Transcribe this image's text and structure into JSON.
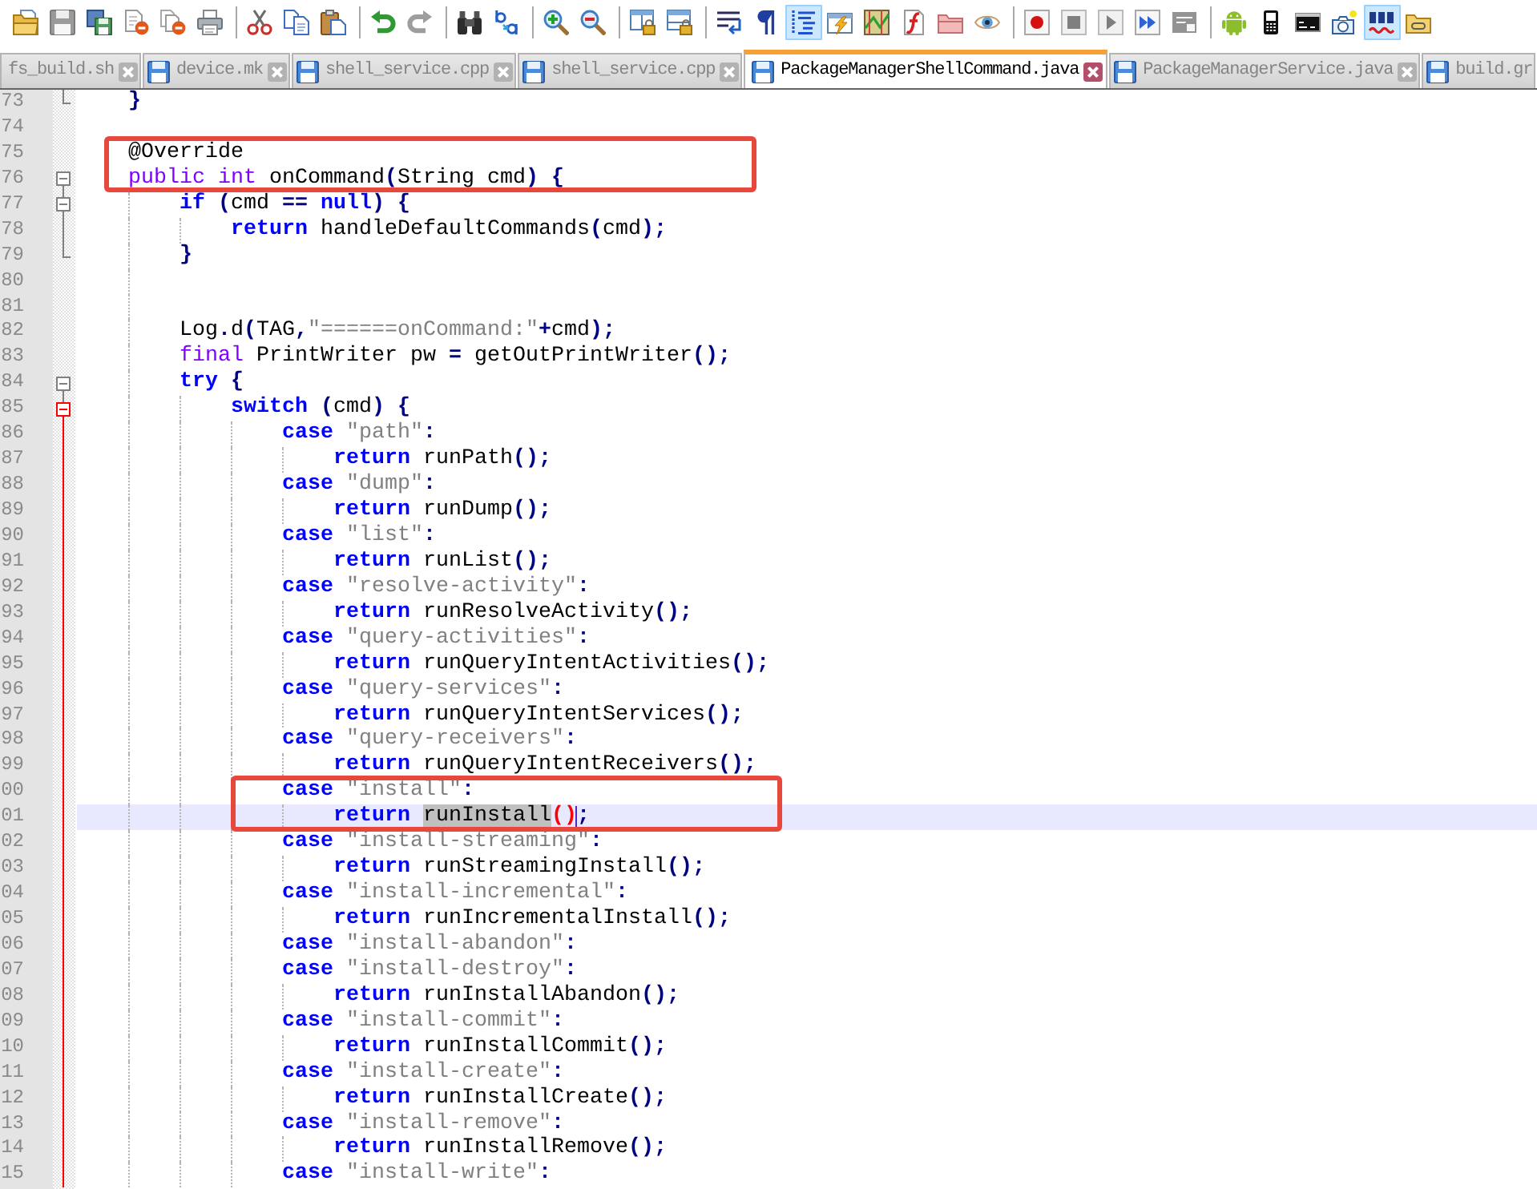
{
  "toolbar": {
    "groups": [
      [
        {
          "kind": "open",
          "pressed": false,
          "disabled": false
        },
        {
          "kind": "save",
          "pressed": false,
          "disabled": true
        },
        {
          "kind": "saveall",
          "pressed": false,
          "disabled": false
        },
        {
          "kind": "close",
          "pressed": false,
          "disabled": false
        },
        {
          "kind": "closeall",
          "pressed": false,
          "disabled": false
        },
        {
          "kind": "print",
          "pressed": false,
          "disabled": false
        }
      ],
      [
        {
          "kind": "cut",
          "pressed": false,
          "disabled": false
        },
        {
          "kind": "copy",
          "pressed": false,
          "disabled": false
        },
        {
          "kind": "paste",
          "pressed": false,
          "disabled": false
        }
      ],
      [
        {
          "kind": "undo",
          "pressed": false,
          "disabled": false
        },
        {
          "kind": "redo",
          "pressed": false,
          "disabled": true
        }
      ],
      [
        {
          "kind": "find",
          "pressed": false,
          "disabled": false
        },
        {
          "kind": "replace",
          "pressed": false,
          "disabled": false
        }
      ],
      [
        {
          "kind": "zoomin",
          "pressed": false,
          "disabled": false
        },
        {
          "kind": "zoomout",
          "pressed": false,
          "disabled": false
        }
      ],
      [
        {
          "kind": "syncv",
          "pressed": false,
          "disabled": false
        },
        {
          "kind": "synch",
          "pressed": false,
          "disabled": false
        }
      ],
      [
        {
          "kind": "wrap",
          "pressed": false,
          "disabled": false
        },
        {
          "kind": "allchars",
          "pressed": false,
          "disabled": false
        },
        {
          "kind": "indentguide",
          "pressed": true,
          "disabled": false
        },
        {
          "kind": "udl",
          "pressed": false,
          "disabled": false
        },
        {
          "kind": "docmap",
          "pressed": false,
          "disabled": false
        },
        {
          "kind": "funclist",
          "pressed": false,
          "disabled": false
        },
        {
          "kind": "folder",
          "pressed": false,
          "disabled": false
        },
        {
          "kind": "monitor",
          "pressed": false,
          "disabled": false
        }
      ],
      [
        {
          "kind": "record",
          "pressed": false,
          "disabled": false
        },
        {
          "kind": "stop",
          "pressed": false,
          "disabled": true
        },
        {
          "kind": "play",
          "pressed": false,
          "disabled": true
        },
        {
          "kind": "playmulti",
          "pressed": false,
          "disabled": false
        },
        {
          "kind": "savemacro",
          "pressed": false,
          "disabled": true
        }
      ],
      [
        {
          "kind": "android",
          "pressed": false,
          "disabled": false
        },
        {
          "kind": "phone",
          "pressed": false,
          "disabled": false
        },
        {
          "kind": "console",
          "pressed": false,
          "disabled": false
        },
        {
          "kind": "snapshot",
          "pressed": false,
          "disabled": false
        },
        {
          "kind": "spellcheck",
          "pressed": true,
          "disabled": false
        },
        {
          "kind": "plugin",
          "pressed": false,
          "disabled": false
        }
      ]
    ]
  },
  "tabs": [
    {
      "label": "fs_build.sh",
      "selected": false,
      "file_icon": false,
      "close_button": true
    },
    {
      "label": "device.mk",
      "selected": false,
      "file_icon": true,
      "close_button": true
    },
    {
      "label": "shell_service.cpp",
      "selected": false,
      "file_icon": true,
      "close_button": true
    },
    {
      "label": "shell_service.cpp",
      "selected": false,
      "file_icon": true,
      "close_button": true
    },
    {
      "label": "PackageManagerShellCommand.java",
      "selected": true,
      "file_icon": true,
      "close_button": true
    },
    {
      "label": "PackageManagerService.java",
      "selected": false,
      "file_icon": true,
      "close_button": true
    },
    {
      "label": "build.gr",
      "selected": false,
      "file_icon": true,
      "close_button": false
    }
  ],
  "editor": {
    "lines": [
      {
        "number": "73",
        "kind": "end",
        "current_fold": false,
        "current": false,
        "annotated": false,
        "tokens": [
          {
            "kind": "operator",
            "text": "}"
          }
        ]
      },
      {
        "number": "74",
        "kind": "plain",
        "current": false,
        "annotated": false
      },
      {
        "number": "75",
        "kind": "plain",
        "current": false,
        "annotated": true,
        "tokens": [
          {
            "kind": "text",
            "text": "@Override"
          }
        ]
      },
      {
        "number": "76",
        "kind": "start",
        "current_fold": false,
        "current": false,
        "annotated": true,
        "tokens": [
          {
            "kind": "type",
            "text": "public"
          },
          {
            "kind": "type",
            "text": " int"
          },
          {
            "kind": "text",
            "text": " onCommand"
          },
          {
            "kind": "operator",
            "text": "("
          },
          {
            "kind": "text",
            "text": "String cmd"
          },
          {
            "kind": "operator",
            "text": ")"
          },
          {
            "kind": "operator",
            "text": " {"
          }
        ],
        "children": [
          {
            "number": "77",
            "kind": "start",
            "current_fold": false,
            "current": false,
            "annotated": false,
            "tokens": [
              {
                "kind": "keyword",
                "text": "if"
              },
              {
                "kind": "operator",
                "text": " ("
              },
              {
                "kind": "text",
                "text": "cmd "
              },
              {
                "kind": "operator",
                "text": "=="
              },
              {
                "kind": "keyword",
                "text": " null"
              },
              {
                "kind": "operator",
                "text": ")"
              },
              {
                "kind": "operator",
                "text": " {"
              }
            ],
            "children": [
              {
                "number": "78",
                "kind": "inside",
                "current_fold": false,
                "current": false,
                "annotated": false,
                "tokens": [
                  {
                    "kind": "keyword",
                    "text": "return"
                  },
                  {
                    "kind": "text",
                    "text": " handleDefaultCommands"
                  },
                  {
                    "kind": "operator",
                    "text": "("
                  },
                  {
                    "kind": "text",
                    "text": "cmd"
                  },
                  {
                    "kind": "operator",
                    "text": ");"
                  }
                ]
              }
            ]
          },
          {
            "number": "79",
            "kind": "end",
            "current_fold": false,
            "current": false,
            "annotated": false,
            "tokens": [
              {
                "kind": "operator",
                "text": "}"
              }
            ]
          },
          {
            "number": "80",
            "kind": "plain",
            "current": false,
            "annotated": false
          },
          {
            "number": "81",
            "kind": "plain",
            "current": false,
            "annotated": false
          },
          {
            "number": "82",
            "kind": "plain",
            "current": false,
            "annotated": false,
            "tokens": [
              {
                "kind": "text",
                "text": "Log"
              },
              {
                "kind": "operator",
                "text": "."
              },
              {
                "kind": "text",
                "text": "d"
              },
              {
                "kind": "operator",
                "text": "("
              },
              {
                "kind": "text",
                "text": "TAG"
              },
              {
                "kind": "operator",
                "text": ","
              },
              {
                "kind": "string",
                "text": "\"======onCommand:\""
              },
              {
                "kind": "operator",
                "text": "+"
              },
              {
                "kind": "text",
                "text": "cmd"
              },
              {
                "kind": "operator",
                "text": ");"
              }
            ]
          },
          {
            "number": "83",
            "kind": "plain",
            "current": false,
            "annotated": false,
            "tokens": [
              {
                "kind": "type",
                "text": "final"
              },
              {
                "kind": "text",
                "text": " PrintWriter pw "
              },
              {
                "kind": "operator",
                "text": "="
              },
              {
                "kind": "text",
                "text": " getOutPrintWriter"
              },
              {
                "kind": "operator",
                "text": "();"
              }
            ]
          },
          {
            "number": "84",
            "kind": "start",
            "current_fold": false,
            "current": false,
            "annotated": false,
            "tokens": [
              {
                "kind": "keyword",
                "text": "try"
              },
              {
                "kind": "operator",
                "text": " {"
              }
            ],
            "children": [
              {
                "number": "85",
                "kind": "start",
                "current_fold": true,
                "current": false,
                "annotated": false,
                "tokens": [
                  {
                    "kind": "keyword",
                    "text": "switch"
                  },
                  {
                    "kind": "operator",
                    "text": " ("
                  },
                  {
                    "kind": "text",
                    "text": "cmd"
                  },
                  {
                    "kind": "operator",
                    "text": ")"
                  },
                  {
                    "kind": "operator",
                    "text": " {"
                  }
                ],
                "children": [
                  {
                    "number": "86",
                    "kind": "inside",
                    "current_fold": true,
                    "current": false,
                    "annotated": false,
                    "tokens": [
                      {
                        "kind": "keyword",
                        "text": "case"
                      },
                      {
                        "kind": "string",
                        "text": " \"path\""
                      },
                      {
                        "kind": "operator",
                        "text": ":"
                      }
                    ],
                    "children": [
                      {
                        "number": "87",
                        "kind": "inside",
                        "current_fold": true,
                        "current": false,
                        "annotated": false,
                        "tokens": [
                          {
                            "kind": "keyword",
                            "text": "return"
                          },
                          {
                            "kind": "text",
                            "text": " runPath"
                          },
                          {
                            "kind": "operator",
                            "text": "();"
                          }
                        ]
                      }
                    ]
                  },
                  {
                    "number": "88",
                    "kind": "inside",
                    "current_fold": true,
                    "current": false,
                    "annotated": false,
                    "tokens": [
                      {
                        "kind": "keyword",
                        "text": "case"
                      },
                      {
                        "kind": "string",
                        "text": " \"dump\""
                      },
                      {
                        "kind": "operator",
                        "text": ":"
                      }
                    ],
                    "children": [
                      {
                        "number": "89",
                        "kind": "inside",
                        "current_fold": true,
                        "current": false,
                        "annotated": false,
                        "tokens": [
                          {
                            "kind": "keyword",
                            "text": "return"
                          },
                          {
                            "kind": "text",
                            "text": " runDump"
                          },
                          {
                            "kind": "operator",
                            "text": "();"
                          }
                        ]
                      }
                    ]
                  },
                  {
                    "number": "90",
                    "kind": "inside",
                    "current_fold": true,
                    "current": false,
                    "annotated": false,
                    "tokens": [
                      {
                        "kind": "keyword",
                        "text": "case"
                      },
                      {
                        "kind": "string",
                        "text": " \"list\""
                      },
                      {
                        "kind": "operator",
                        "text": ":"
                      }
                    ],
                    "children": [
                      {
                        "number": "91",
                        "kind": "inside",
                        "current_fold": true,
                        "current": false,
                        "annotated": false,
                        "tokens": [
                          {
                            "kind": "keyword",
                            "text": "return"
                          },
                          {
                            "kind": "text",
                            "text": " runList"
                          },
                          {
                            "kind": "operator",
                            "text": "();"
                          }
                        ]
                      }
                    ]
                  },
                  {
                    "number": "92",
                    "kind": "inside",
                    "current_fold": true,
                    "current": false,
                    "annotated": false,
                    "tokens": [
                      {
                        "kind": "keyword",
                        "text": "case"
                      },
                      {
                        "kind": "string",
                        "text": " \"resolve-activity\""
                      },
                      {
                        "kind": "operator",
                        "text": ":"
                      }
                    ],
                    "children": [
                      {
                        "number": "93",
                        "kind": "inside",
                        "current_fold": true,
                        "current": false,
                        "annotated": false,
                        "tokens": [
                          {
                            "kind": "keyword",
                            "text": "return"
                          },
                          {
                            "kind": "text",
                            "text": " runResolveActivity"
                          },
                          {
                            "kind": "operator",
                            "text": "();"
                          }
                        ]
                      }
                    ]
                  },
                  {
                    "number": "94",
                    "kind": "inside",
                    "current_fold": true,
                    "current": false,
                    "annotated": false,
                    "tokens": [
                      {
                        "kind": "keyword",
                        "text": "case"
                      },
                      {
                        "kind": "string",
                        "text": " \"query-activities\""
                      },
                      {
                        "kind": "operator",
                        "text": ":"
                      }
                    ],
                    "children": [
                      {
                        "number": "95",
                        "kind": "inside",
                        "current_fold": true,
                        "current": false,
                        "annotated": false,
                        "tokens": [
                          {
                            "kind": "keyword",
                            "text": "return"
                          },
                          {
                            "kind": "text",
                            "text": " runQueryIntentActivities"
                          },
                          {
                            "kind": "operator",
                            "text": "();"
                          }
                        ]
                      }
                    ]
                  },
                  {
                    "number": "96",
                    "kind": "inside",
                    "current_fold": true,
                    "current": false,
                    "annotated": false,
                    "tokens": [
                      {
                        "kind": "keyword",
                        "text": "case"
                      },
                      {
                        "kind": "string",
                        "text": " \"query-services\""
                      },
                      {
                        "kind": "operator",
                        "text": ":"
                      }
                    ],
                    "children": [
                      {
                        "number": "97",
                        "kind": "inside",
                        "current_fold": true,
                        "current": false,
                        "annotated": false,
                        "tokens": [
                          {
                            "kind": "keyword",
                            "text": "return"
                          },
                          {
                            "kind": "text",
                            "text": " runQueryIntentServices"
                          },
                          {
                            "kind": "operator",
                            "text": "();"
                          }
                        ]
                      }
                    ]
                  },
                  {
                    "number": "98",
                    "kind": "inside",
                    "current_fold": true,
                    "current": false,
                    "annotated": false,
                    "tokens": [
                      {
                        "kind": "keyword",
                        "text": "case"
                      },
                      {
                        "kind": "string",
                        "text": " \"query-receivers\""
                      },
                      {
                        "kind": "operator",
                        "text": ":"
                      }
                    ],
                    "children": [
                      {
                        "number": "99",
                        "kind": "inside",
                        "current_fold": true,
                        "current": false,
                        "annotated": false,
                        "tokens": [
                          {
                            "kind": "keyword",
                            "text": "return"
                          },
                          {
                            "kind": "text",
                            "text": " runQueryIntentReceivers"
                          },
                          {
                            "kind": "operator",
                            "text": "();"
                          }
                        ]
                      }
                    ]
                  },
                  {
                    "number": "00",
                    "kind": "inside",
                    "current_fold": true,
                    "current": false,
                    "annotated": true,
                    "tokens": [
                      {
                        "kind": "keyword",
                        "text": "case"
                      },
                      {
                        "kind": "string",
                        "text": " \"install\""
                      },
                      {
                        "kind": "operator",
                        "text": ":"
                      }
                    ],
                    "children": [
                      {
                        "number": "01",
                        "kind": "inside",
                        "current_fold": true,
                        "current": true,
                        "annotated": true,
                        "tokens": [
                          {
                            "kind": "keyword",
                            "text": "return "
                          },
                          {
                            "kind": "selection",
                            "text": "runInstall"
                          },
                          {
                            "kind": "brace",
                            "text": "("
                          },
                          {
                            "kind": "brace",
                            "text": ")"
                          },
                          {
                            "kind": "caret"
                          },
                          {
                            "kind": "operator",
                            "text": ";"
                          }
                        ]
                      }
                    ]
                  },
                  {
                    "number": "02",
                    "kind": "inside",
                    "current_fold": true,
                    "current": false,
                    "annotated": false,
                    "tokens": [
                      {
                        "kind": "keyword",
                        "text": "case"
                      },
                      {
                        "kind": "string",
                        "text": " \"install-streaming\""
                      },
                      {
                        "kind": "operator",
                        "text": ":"
                      }
                    ],
                    "children": [
                      {
                        "number": "03",
                        "kind": "inside",
                        "current_fold": true,
                        "current": false,
                        "annotated": false,
                        "tokens": [
                          {
                            "kind": "keyword",
                            "text": "return"
                          },
                          {
                            "kind": "text",
                            "text": " runStreamingInstall"
                          },
                          {
                            "kind": "operator",
                            "text": "();"
                          }
                        ]
                      }
                    ]
                  },
                  {
                    "number": "04",
                    "kind": "inside",
                    "current_fold": true,
                    "current": false,
                    "annotated": false,
                    "tokens": [
                      {
                        "kind": "keyword",
                        "text": "case"
                      },
                      {
                        "kind": "string",
                        "text": " \"install-incremental\""
                      },
                      {
                        "kind": "operator",
                        "text": ":"
                      }
                    ],
                    "children": [
                      {
                        "number": "05",
                        "kind": "inside",
                        "current_fold": true,
                        "current": false,
                        "annotated": false,
                        "tokens": [
                          {
                            "kind": "keyword",
                            "text": "return"
                          },
                          {
                            "kind": "text",
                            "text": " runIncrementalInstall"
                          },
                          {
                            "kind": "operator",
                            "text": "();"
                          }
                        ]
                      }
                    ]
                  },
                  {
                    "number": "06",
                    "kind": "inside",
                    "current_fold": true,
                    "current": false,
                    "annotated": false,
                    "tokens": [
                      {
                        "kind": "keyword",
                        "text": "case"
                      },
                      {
                        "kind": "string",
                        "text": " \"install-abandon\""
                      },
                      {
                        "kind": "operator",
                        "text": ":"
                      }
                    ]
                  },
                  {
                    "number": "07",
                    "kind": "inside",
                    "current_fold": true,
                    "current": false,
                    "annotated": false,
                    "tokens": [
                      {
                        "kind": "keyword",
                        "text": "case"
                      },
                      {
                        "kind": "string",
                        "text": " \"install-destroy\""
                      },
                      {
                        "kind": "operator",
                        "text": ":"
                      }
                    ],
                    "children": [
                      {
                        "number": "08",
                        "kind": "inside",
                        "current_fold": true,
                        "current": false,
                        "annotated": false,
                        "tokens": [
                          {
                            "kind": "keyword",
                            "text": "return"
                          },
                          {
                            "kind": "text",
                            "text": " runInstallAbandon"
                          },
                          {
                            "kind": "operator",
                            "text": "();"
                          }
                        ]
                      }
                    ]
                  },
                  {
                    "number": "09",
                    "kind": "inside",
                    "current_fold": true,
                    "current": false,
                    "annotated": false,
                    "tokens": [
                      {
                        "kind": "keyword",
                        "text": "case"
                      },
                      {
                        "kind": "string",
                        "text": " \"install-commit\""
                      },
                      {
                        "kind": "operator",
                        "text": ":"
                      }
                    ],
                    "children": [
                      {
                        "number": "10",
                        "kind": "inside",
                        "current_fold": true,
                        "current": false,
                        "annotated": false,
                        "tokens": [
                          {
                            "kind": "keyword",
                            "text": "return"
                          },
                          {
                            "kind": "text",
                            "text": " runInstallCommit"
                          },
                          {
                            "kind": "operator",
                            "text": "();"
                          }
                        ]
                      }
                    ]
                  },
                  {
                    "number": "11",
                    "kind": "inside",
                    "current_fold": true,
                    "current": false,
                    "annotated": false,
                    "tokens": [
                      {
                        "kind": "keyword",
                        "text": "case"
                      },
                      {
                        "kind": "string",
                        "text": " \"install-create\""
                      },
                      {
                        "kind": "operator",
                        "text": ":"
                      }
                    ],
                    "children": [
                      {
                        "number": "12",
                        "kind": "inside",
                        "current_fold": true,
                        "current": false,
                        "annotated": false,
                        "tokens": [
                          {
                            "kind": "keyword",
                            "text": "return"
                          },
                          {
                            "kind": "text",
                            "text": " runInstallCreate"
                          },
                          {
                            "kind": "operator",
                            "text": "();"
                          }
                        ]
                      }
                    ]
                  },
                  {
                    "number": "13",
                    "kind": "inside",
                    "current_fold": true,
                    "current": false,
                    "annotated": false,
                    "tokens": [
                      {
                        "kind": "keyword",
                        "text": "case"
                      },
                      {
                        "kind": "string",
                        "text": " \"install-remove\""
                      },
                      {
                        "kind": "operator",
                        "text": ":"
                      }
                    ],
                    "children": [
                      {
                        "number": "14",
                        "kind": "inside",
                        "current_fold": true,
                        "current": false,
                        "annotated": false,
                        "tokens": [
                          {
                            "kind": "keyword",
                            "text": "return"
                          },
                          {
                            "kind": "text",
                            "text": " runInstallRemove"
                          },
                          {
                            "kind": "operator",
                            "text": "();"
                          }
                        ]
                      }
                    ]
                  },
                  {
                    "number": "15",
                    "kind": "inside",
                    "current_fold": true,
                    "current": false,
                    "annotated": false,
                    "tokens": [
                      {
                        "kind": "keyword",
                        "text": "case"
                      },
                      {
                        "kind": "string",
                        "text": " \"install-write\""
                      },
                      {
                        "kind": "operator",
                        "text": ":"
                      }
                    ]
                  }
                ]
              }
            ]
          }
        ]
      }
    ]
  }
}
